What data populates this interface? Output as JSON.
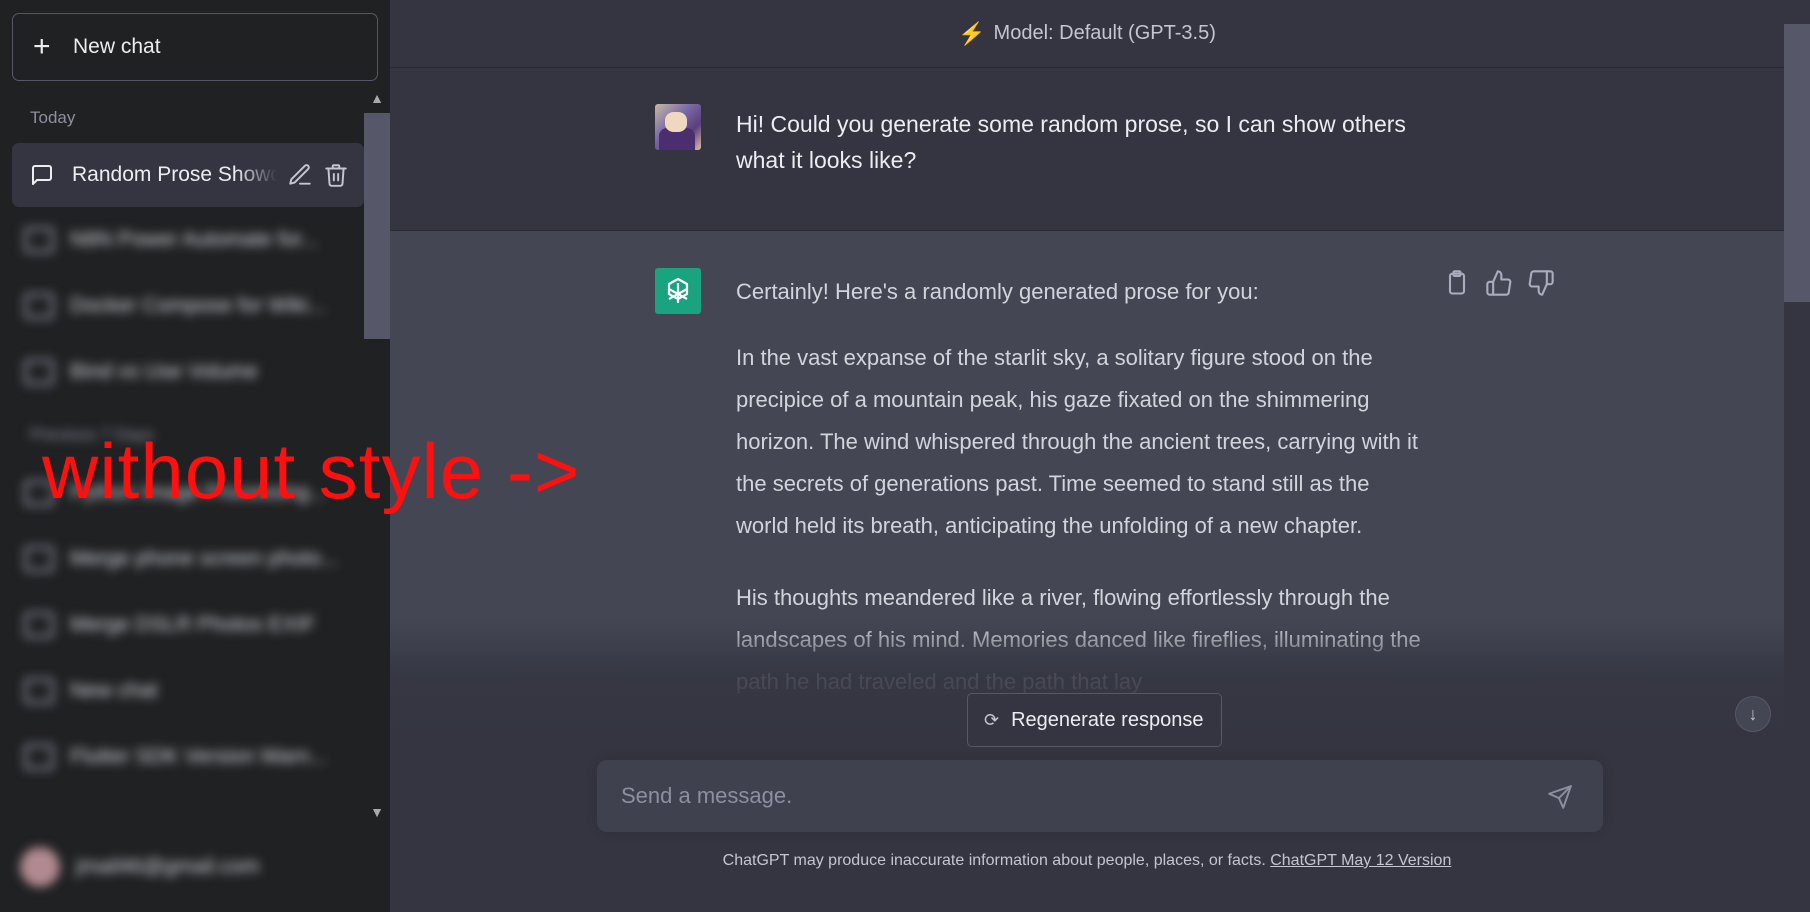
{
  "sidebar": {
    "new_chat_label": "New chat",
    "section_today": "Today",
    "active_chat": "Random Prose Showcase",
    "blurred_section": "Previous 7 Days",
    "blurred_items": [
      "N8N Power Automate for...",
      "Docker Compose for Wiki...",
      "Bind vs Use Volume",
      "Python Image Processing...",
      "Merge phone screen photo...",
      "Merge DSLR Photos EXIF",
      "New chat",
      "Flutter SDK Version Warn..."
    ],
    "user_email": "jmail46@gmail.com"
  },
  "header": {
    "model_label": "Model: Default (GPT-3.5)"
  },
  "conversation": {
    "user_message": "Hi! Could you generate some random prose, so I can show others what it looks like?",
    "assistant_intro": "Certainly! Here's a randomly generated prose for you:",
    "assistant_p1": "In the vast expanse of the starlit sky, a solitary figure stood on the precipice of a mountain peak, his gaze fixated on the shimmering horizon. The wind whispered through the ancient trees, carrying with it the secrets of generations past. Time seemed to stand still as the world held its breath, anticipating the unfolding of a new chapter.",
    "assistant_p2": "His thoughts meandered like a river, flowing effortlessly through the landscapes of his mind. Memories danced like fireflies, illuminating the path he had traveled and the path that lay"
  },
  "controls": {
    "regenerate_label": "Regenerate response",
    "input_placeholder": "Send a message."
  },
  "footer": {
    "disclaimer": "ChatGPT may produce inaccurate information about people, places, or facts.",
    "version_link": "ChatGPT May 12 Version"
  },
  "annotation": {
    "text": "without style ->",
    "color": "#ff1010"
  },
  "colors": {
    "sidebar_bg": "#202123",
    "main_bg": "#444654",
    "user_bg": "#343541",
    "assistant_avatar": "#19a37f"
  }
}
